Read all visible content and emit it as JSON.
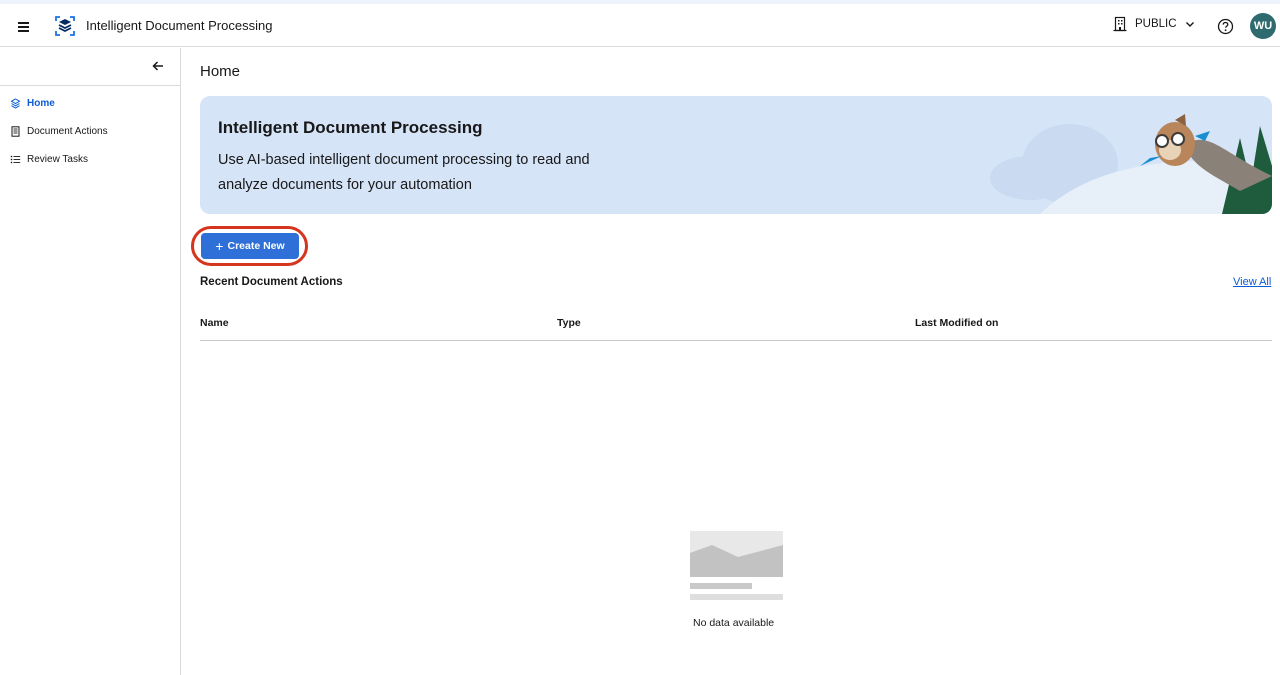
{
  "header": {
    "app_title": "Intelligent Document Processing",
    "org_name": "PUBLIC",
    "avatar_initials": "WU",
    "avatar_color": "#2f6b6e"
  },
  "sidebar": {
    "items": [
      {
        "label": "Home",
        "icon": "home-icon",
        "active": true
      },
      {
        "label": "Document Actions",
        "icon": "document-icon",
        "active": false
      },
      {
        "label": "Review Tasks",
        "icon": "list-icon",
        "active": false
      }
    ]
  },
  "main": {
    "page_title": "Home",
    "banner": {
      "title": "Intelligent Document Processing",
      "text": "Use AI-based intelligent document processing to read and analyze documents for your automation"
    },
    "create_button": "Create New",
    "recent": {
      "title": "Recent Document Actions",
      "view_all": "View All",
      "columns": [
        "Name",
        "Type",
        "Last Modified on"
      ],
      "rows": [],
      "empty_text": "No data available"
    }
  },
  "colors": {
    "accent": "#0b5cd5",
    "button": "#2e6fd8",
    "highlight_ring": "#d5351f",
    "banner_bg": "#d6e4f8"
  }
}
